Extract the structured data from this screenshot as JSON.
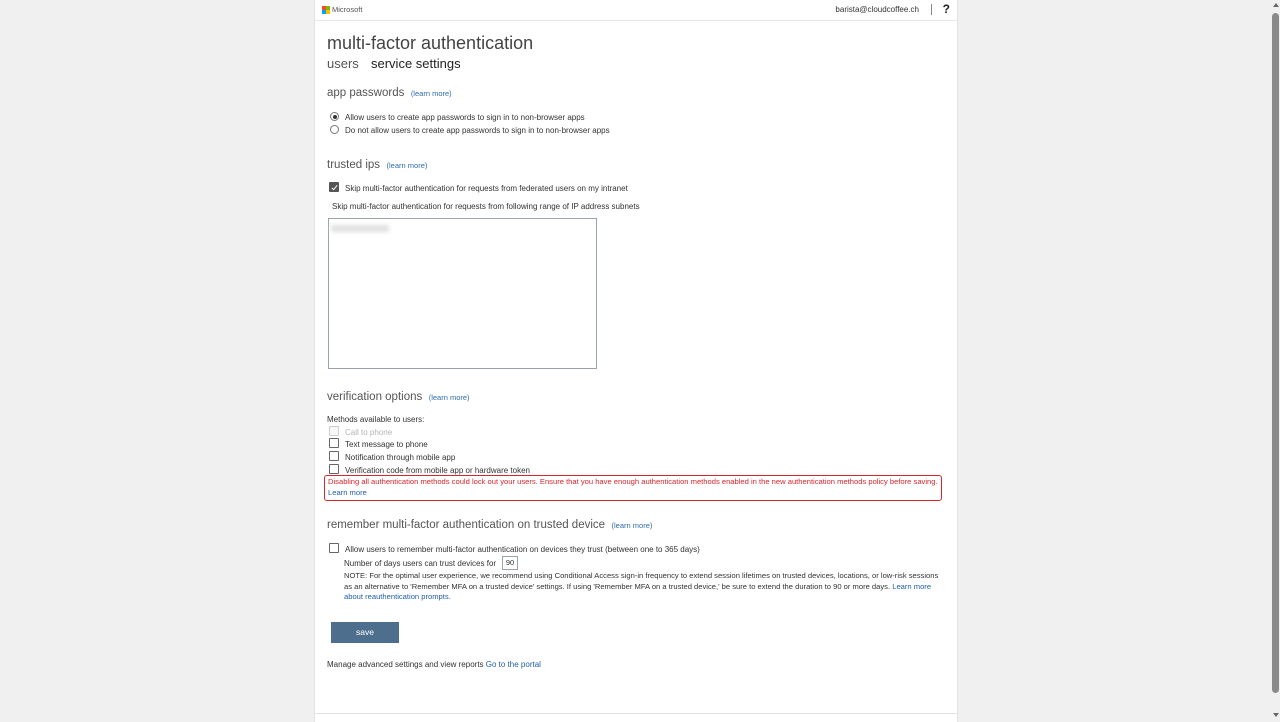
{
  "header": {
    "brand": "Microsoft",
    "user_email": "barista@cloudcoffee.ch",
    "help_label": "?"
  },
  "page_title": "multi-factor authentication",
  "tabs": [
    {
      "label": "users",
      "active": false
    },
    {
      "label": "service settings",
      "active": true
    }
  ],
  "learn_more_label": "(learn more)",
  "app_passwords": {
    "heading": "app passwords",
    "options": [
      {
        "label": "Allow users to create app passwords to sign in to non-browser apps",
        "selected": true
      },
      {
        "label": "Do not allow users to create app passwords to sign in to non-browser apps",
        "selected": false
      }
    ]
  },
  "trusted_ips": {
    "heading": "trusted ips",
    "skip_federated_label": "Skip multi-factor authentication for requests from federated users on my intranet",
    "skip_federated_checked": true,
    "range_label": "Skip multi-factor authentication for requests from following range of IP address subnets"
  },
  "verification_options": {
    "heading": "verification options",
    "methods_label": "Methods available to users:",
    "methods": [
      {
        "label": "Call to phone",
        "checked": false,
        "disabled": true
      },
      {
        "label": "Text message to phone",
        "checked": false,
        "disabled": false
      },
      {
        "label": "Notification through mobile app",
        "checked": false,
        "disabled": false
      },
      {
        "label": "Verification code from mobile app or hardware token",
        "checked": false,
        "disabled": false
      }
    ],
    "warning_text": "Disabling all authentication methods could lock out your users. Ensure that you have enough authentication methods enabled in the new authentication methods policy before saving.",
    "warning_link": "Learn more"
  },
  "remember_mfa": {
    "heading": "remember multi-factor authentication on trusted device",
    "allow_label": "Allow users to remember multi-factor authentication on devices they trust (between one to 365 days)",
    "allow_checked": false,
    "days_label": "Number of days users can trust devices for",
    "days_value": "90",
    "note_text": "NOTE: For the optimal user experience, we recommend using Conditional Access sign-in frequency to extend session lifetimes on trusted devices, locations, or low-risk sessions as an alternative to 'Remember MFA on a trusted device' settings. If using 'Remember MFA on a trusted device,' be sure to extend the duration to 90 or more days.",
    "note_link": "Learn more about reauthentication prompts."
  },
  "save_label": "save",
  "footer": {
    "text": "Manage advanced settings and view reports",
    "link": "Go to the portal"
  },
  "colors": {
    "accent_link": "#1f5fa8",
    "warning": "#d9262c",
    "save_button": "#4e6e8e"
  }
}
